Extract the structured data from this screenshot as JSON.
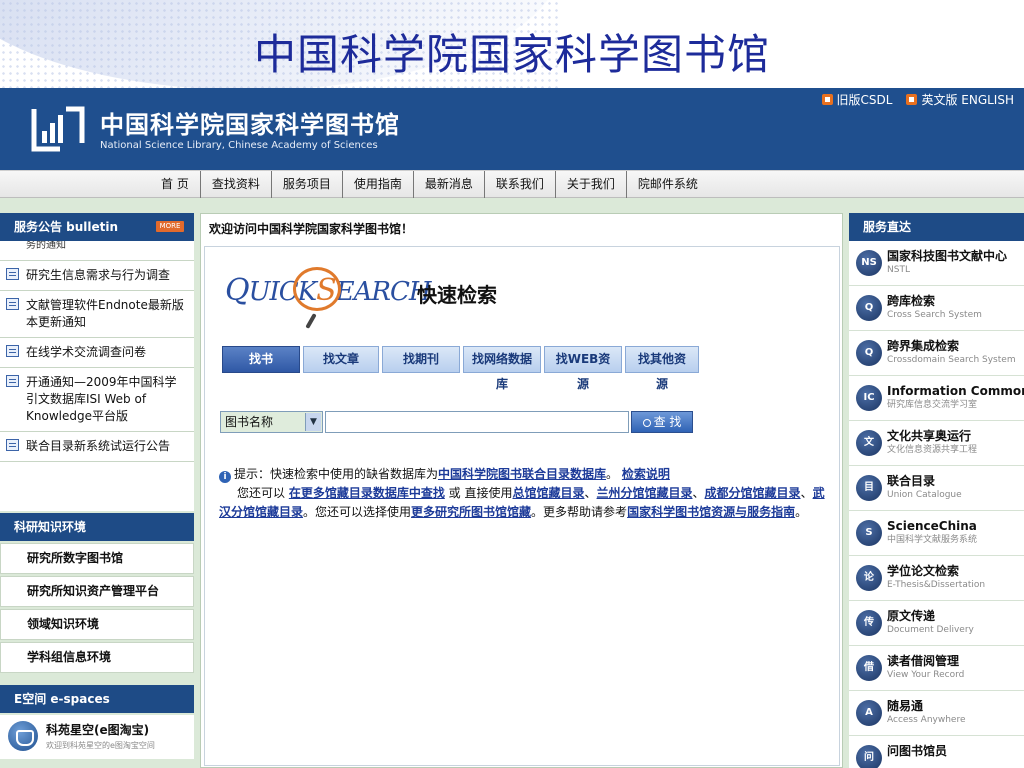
{
  "slide_title": "中国科学院国家科学图书馆",
  "site": {
    "name_cn": "中国科学院国家科学图书馆",
    "name_en": "National Science Library, Chinese Academy of Sciences",
    "top_links": [
      "旧版CSDL",
      "英文版 ENGLISH"
    ]
  },
  "nav": [
    "首 页",
    "查找资料",
    "服务项目",
    "使用指南",
    "最新消息",
    "联系我们",
    "关于我们",
    "院邮件系统"
  ],
  "bulletin": {
    "title": "服务公告  bulletin",
    "more": "MORE",
    "cut_item": "务的通知",
    "items": [
      "研究生信息需求与行为调查",
      "文献管理软件Endnote最新版本更新通知",
      "在线学术交流调查问卷",
      "开通通知—2009年中国科学引文数据库ISI Web of Knowledge平台版",
      "联合目录新系统试运行公告"
    ]
  },
  "knowledge": {
    "title": "科研知识环境",
    "items": [
      "研究所数字图书馆",
      "研究所知识资产管理平台",
      "领域知识环境",
      "学科组信息环境"
    ]
  },
  "espace": {
    "title": "E空间  e-spaces",
    "item_title": "科苑星空(e图淘宝)",
    "item_sub": "欢迎到科苑星空的e图淘宝空间"
  },
  "center": {
    "welcome": "欢迎访问中国科学院国家科学图书馆！",
    "quicksearch_cn": "快速检索",
    "tabs": [
      "找书",
      "找文章",
      "找期刊",
      "找网络数据库",
      "找WEB资源",
      "找其他资源"
    ],
    "select_value": "图书名称",
    "search_value": "",
    "search_button": "查 找",
    "tip_prefix": "提示：快速检索中使用的缺省数据库为",
    "tip_link1": "中国科学院图书联合目录数据库",
    "tip_mid": "。 ",
    "tip_link2": "检索说明",
    "line2_a": "您还可以 ",
    "line2_link1": "在更多馆藏目录数据库中查找",
    "line2_b": " 或 直接使用",
    "line2_link2": "总馆馆藏目录",
    "line2_sep1": "、",
    "line2_link3": "兰州分馆馆藏目录",
    "line2_sep2": "、",
    "line2_link4": "成都分馆馆藏目录",
    "line2_sep3": "、",
    "line2_link5": "武汉分馆馆藏目录",
    "line2_c": "。您还可以选择使用",
    "line2_link6": "更多研究所图书馆馆藏",
    "line2_d": "。更多帮助请参考",
    "line2_link7": "国家科学图书馆资源与服务指南",
    "line2_e": "。"
  },
  "services": {
    "title": "服务直达",
    "items": [
      {
        "title": "国家科技图书文献中心",
        "sub": "NSTL",
        "icon": "NS"
      },
      {
        "title": "跨库检索",
        "sub": "Cross Search System",
        "icon": "Q"
      },
      {
        "title": "跨界集成检索",
        "sub": "Crossdomain Search System",
        "icon": "Q"
      },
      {
        "title": "Information Commons",
        "sub": "研究库信息交流学习室",
        "icon": "IC"
      },
      {
        "title": "文化共享奥运行",
        "sub": "文化信息资源共享工程",
        "icon": "文"
      },
      {
        "title": "联合目录",
        "sub": "Union Catalogue",
        "icon": "目"
      },
      {
        "title": "ScienceChina",
        "sub": "中国科学文献服务系统",
        "icon": "S"
      },
      {
        "title": "学位论文检索",
        "sub": "E-Thesis&Dissertation",
        "icon": "论"
      },
      {
        "title": "原文传递",
        "sub": "Document Delivery",
        "icon": "传"
      },
      {
        "title": "读者借阅管理",
        "sub": "View Your Record",
        "icon": "借"
      },
      {
        "title": "随易通",
        "sub": "Access Anywhere",
        "icon": "A"
      },
      {
        "title": "问图书馆员",
        "sub": "",
        "icon": "问"
      }
    ]
  }
}
